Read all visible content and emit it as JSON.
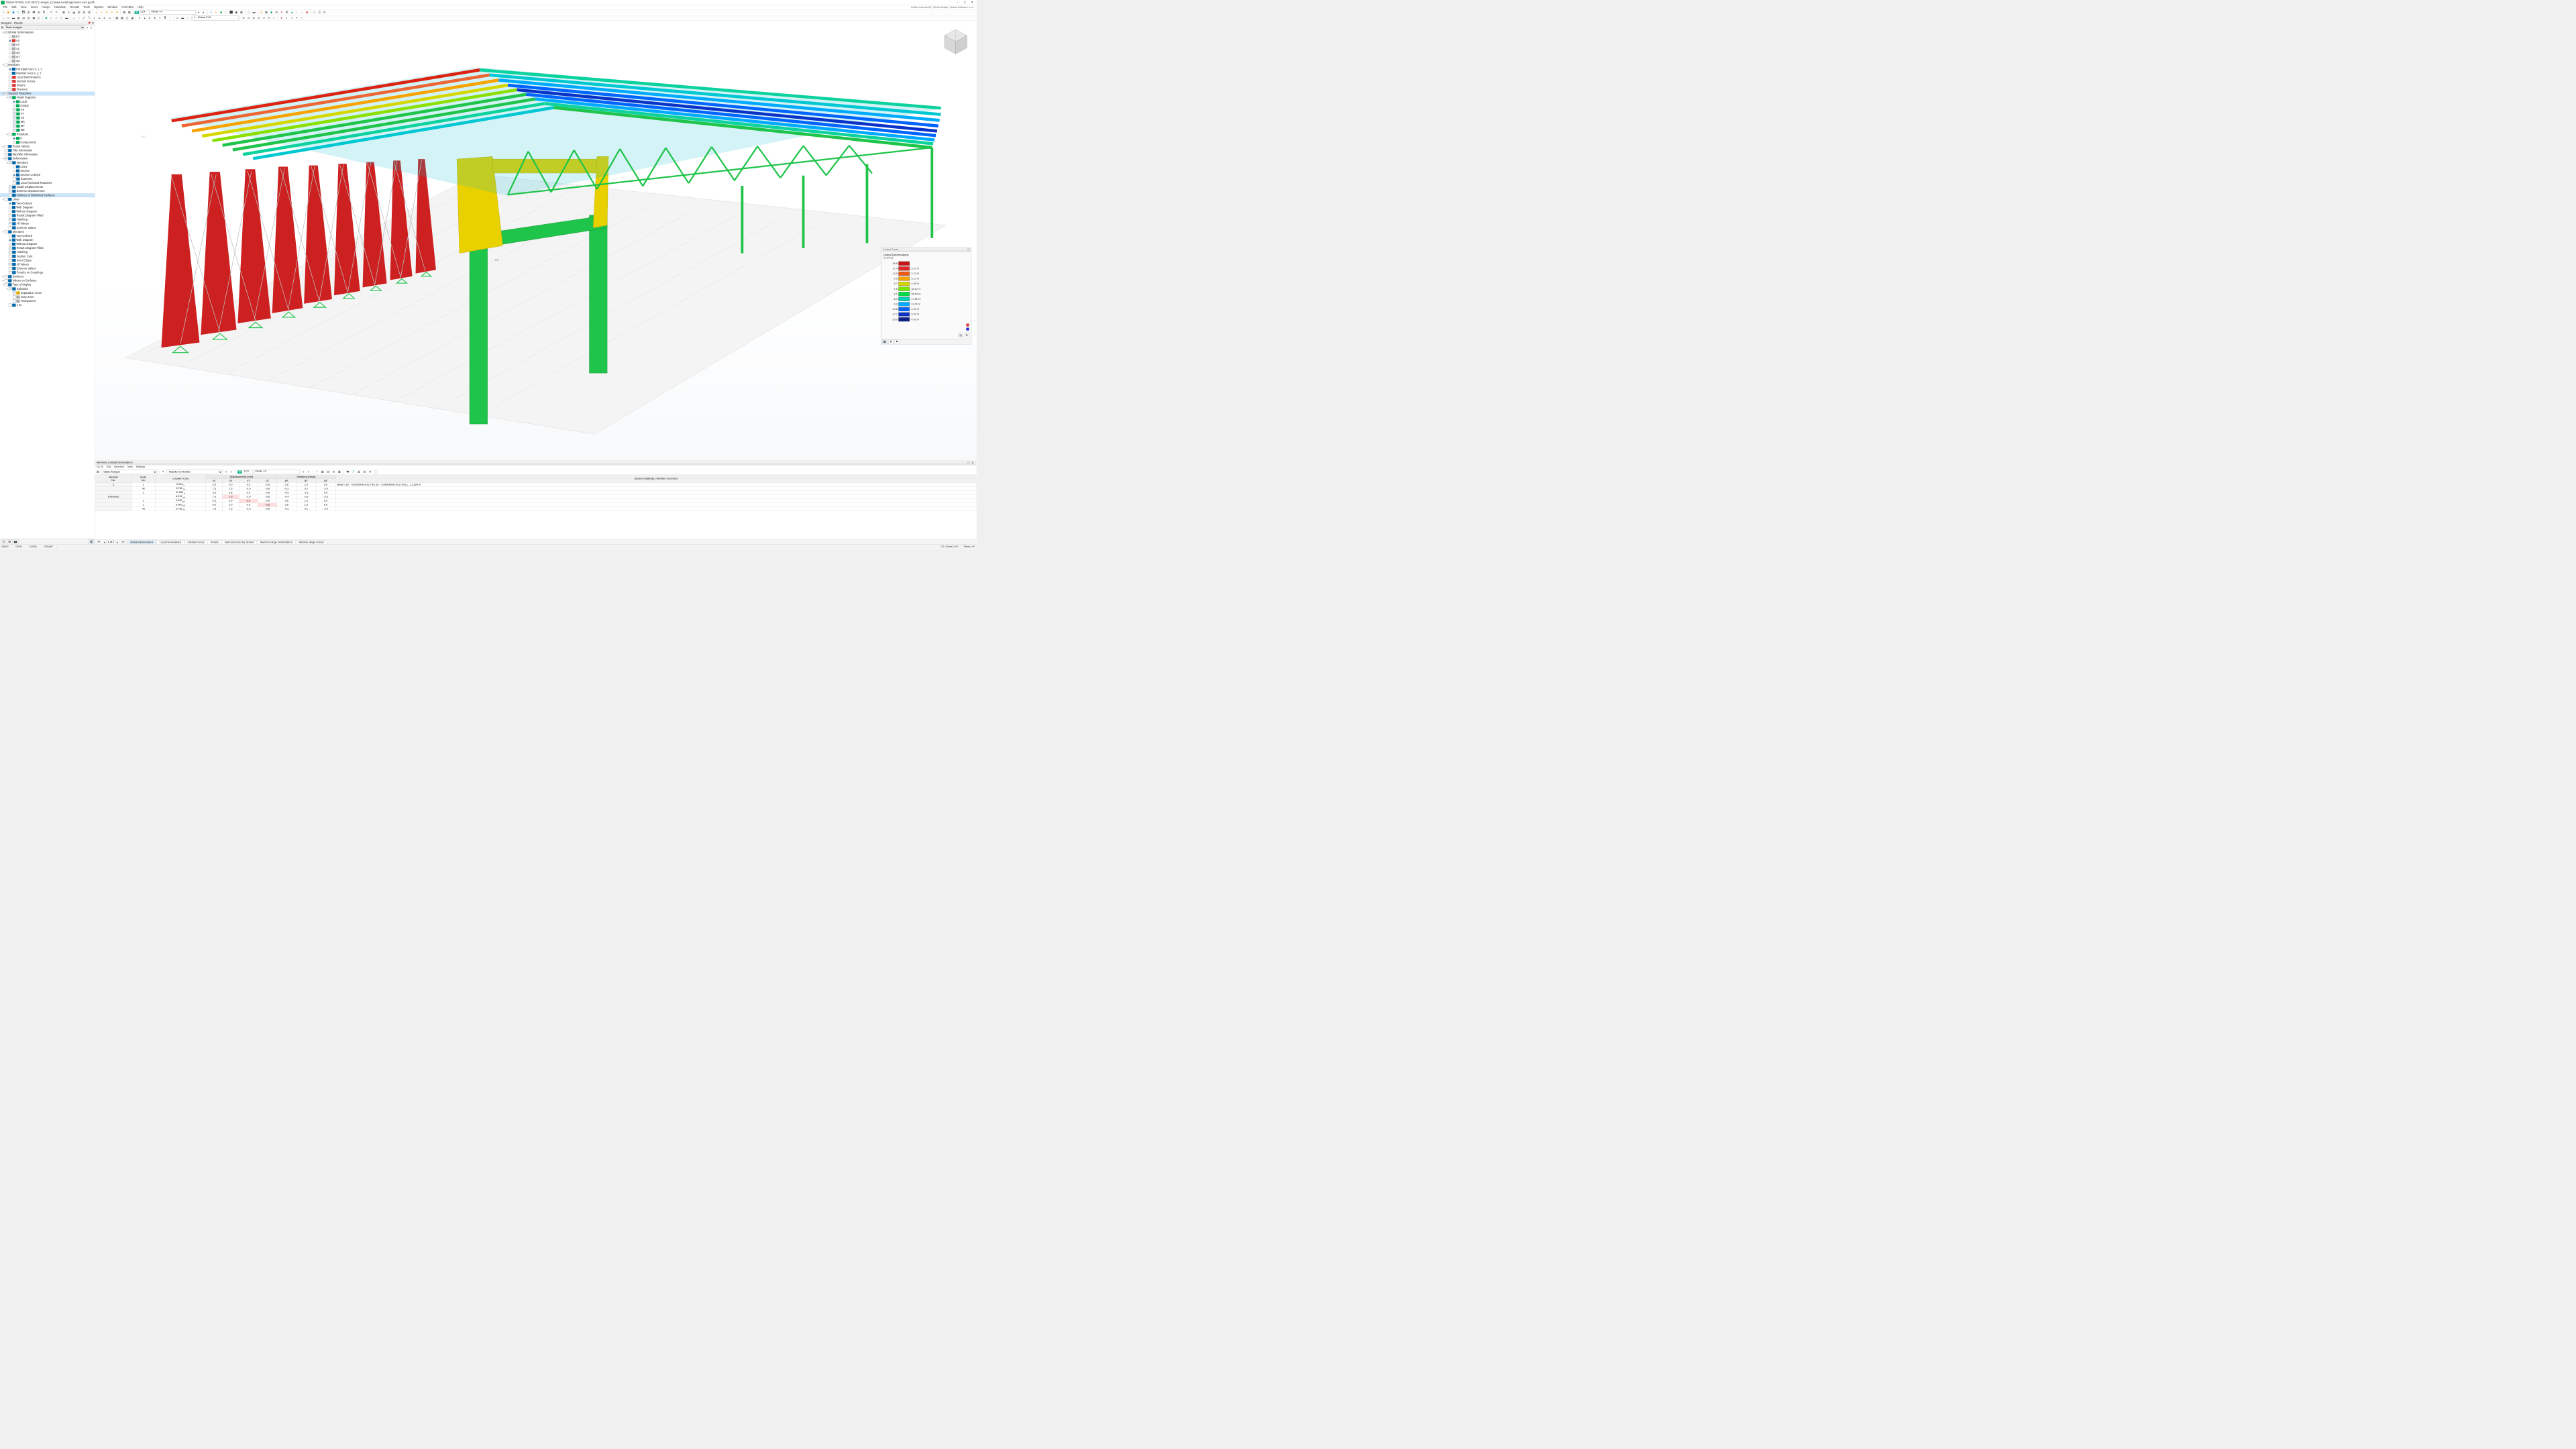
{
  "title": "Dlubal RFEM | 6.02.0047 | Hangar_(C)www.metalurgicavera.com.py.rf5",
  "license": "Online License 53 | Martin Motlik | Dlubal Software s.r.o.",
  "menus": [
    "File",
    "Edit",
    "View",
    "Insert",
    "Assign",
    "Calculate",
    "Results",
    "Tools",
    "Options",
    "Window",
    "CAD-BIM",
    "Help"
  ],
  "lc_badge": "LC4",
  "lc_dropdown": "Viento +X",
  "coord_dropdown": "1 - Global XYZ",
  "nav": {
    "title": "Navigator - Results",
    "analysis": "Static Analysis",
    "tree": [
      {
        "d": 0,
        "caret": "▾",
        "chk": true,
        "lbl": "Global Deformations"
      },
      {
        "d": 1,
        "radio": false,
        "icon": "ti-gray",
        "lbl": "|u|"
      },
      {
        "d": 1,
        "radio": true,
        "icon": "ti-red",
        "lbl": "uX"
      },
      {
        "d": 1,
        "radio": false,
        "icon": "ti-gray",
        "lbl": "uY"
      },
      {
        "d": 1,
        "radio": false,
        "icon": "ti-gray",
        "lbl": "uZ"
      },
      {
        "d": 1,
        "radio": false,
        "icon": "ti-gray",
        "lbl": "φX"
      },
      {
        "d": 1,
        "radio": false,
        "icon": "ti-gray",
        "lbl": "φY"
      },
      {
        "d": 1,
        "radio": false,
        "icon": "ti-gray",
        "lbl": "φZ"
      },
      {
        "d": 0,
        "caret": "▾",
        "chk": false,
        "lbl": "Members"
      },
      {
        "d": 1,
        "radio": true,
        "icon": "ti-blue",
        "lbl": "Principal Axes s, u, v"
      },
      {
        "d": 1,
        "radio": false,
        "icon": "ti-blue",
        "lbl": "Member Axes x, y, z"
      },
      {
        "d": 1,
        "chk": false,
        "icon": "ti-red",
        "lbl": "Local Deformations"
      },
      {
        "d": 1,
        "chk": false,
        "icon": "ti-red",
        "lbl": "Internal Forces"
      },
      {
        "d": 1,
        "chk": false,
        "icon": "ti-red",
        "lbl": "Strains"
      },
      {
        "d": 1,
        "chk": false,
        "icon": "ti-red",
        "lbl": "Stresses"
      },
      {
        "d": 0,
        "caret": "▾",
        "chk": true,
        "lbl": "Support Reactions",
        "sel": true
      },
      {
        "d": 1,
        "caret": "▾",
        "chk": true,
        "icon": "ti-green",
        "lbl": "Nodal Supports"
      },
      {
        "d": 2,
        "radio": true,
        "icon": "ti-green",
        "lbl": "Local"
      },
      {
        "d": 2,
        "radio": false,
        "icon": "ti-green",
        "lbl": "Global"
      },
      {
        "d": 2,
        "chk": true,
        "icon": "ti-green",
        "lbl": "PX"
      },
      {
        "d": 2,
        "chk": true,
        "icon": "ti-green",
        "lbl": "PY"
      },
      {
        "d": 2,
        "chk": true,
        "icon": "ti-green",
        "lbl": "PZ"
      },
      {
        "d": 2,
        "chk": true,
        "icon": "ti-green",
        "lbl": "MX"
      },
      {
        "d": 2,
        "chk": true,
        "icon": "ti-green",
        "lbl": "MY"
      },
      {
        "d": 2,
        "chk": true,
        "icon": "ti-green",
        "lbl": "MZ"
      },
      {
        "d": 1,
        "caret": "▾",
        "chk": false,
        "icon": "ti-green",
        "lbl": "Resultant"
      },
      {
        "d": 2,
        "radio": true,
        "icon": "ti-green",
        "lbl": "P"
      },
      {
        "d": 2,
        "radio": false,
        "icon": "ti-green",
        "lbl": "Components"
      },
      {
        "d": 0,
        "caret": "▸",
        "chk": false,
        "icon": "ti-blue",
        "lbl": "Result Values"
      },
      {
        "d": 0,
        "chk": false,
        "icon": "ti-blue",
        "lbl": "Title Information"
      },
      {
        "d": 0,
        "chk": false,
        "icon": "ti-blue",
        "lbl": "Max/Min Information"
      },
      {
        "d": 0,
        "caret": "▾",
        "chk": true,
        "icon": "ti-blue",
        "lbl": "Deformation"
      },
      {
        "d": 1,
        "caret": "▾",
        "chk": true,
        "icon": "ti-blue",
        "lbl": "Members"
      },
      {
        "d": 2,
        "radio": false,
        "icon": "ti-blue",
        "lbl": "Lines"
      },
      {
        "d": 2,
        "radio": false,
        "icon": "ti-blue",
        "lbl": "Section"
      },
      {
        "d": 2,
        "radio": true,
        "icon": "ti-blue",
        "lbl": "Section Colored"
      },
      {
        "d": 2,
        "chk": false,
        "icon": "ti-blue",
        "lbl": "Extremes"
      },
      {
        "d": 2,
        "chk": false,
        "icon": "ti-blue",
        "lbl": "Local Torsional Rotations"
      },
      {
        "d": 1,
        "chk": true,
        "icon": "ti-blue",
        "lbl": "Nodal Displacements"
      },
      {
        "d": 1,
        "chk": true,
        "icon": "ti-blue",
        "lbl": "Extreme Displacement"
      },
      {
        "d": 1,
        "chk": false,
        "icon": "ti-blue",
        "lbl": "Outlines of Deformed Surfaces",
        "sel": true
      },
      {
        "d": 0,
        "caret": "▾",
        "chk": false,
        "icon": "ti-blue",
        "lbl": "Lines"
      },
      {
        "d": 1,
        "radio": true,
        "icon": "ti-blue",
        "lbl": "Two-Colored"
      },
      {
        "d": 1,
        "radio": false,
        "icon": "ti-blue",
        "lbl": "With Diagram"
      },
      {
        "d": 1,
        "radio": false,
        "icon": "ti-blue",
        "lbl": "Without Diagram"
      },
      {
        "d": 1,
        "chk": false,
        "icon": "ti-blue",
        "lbl": "Result Diagram Filled"
      },
      {
        "d": 1,
        "chk": true,
        "icon": "ti-blue",
        "lbl": "Hatching"
      },
      {
        "d": 1,
        "chk": true,
        "icon": "ti-blue",
        "lbl": "All Values"
      },
      {
        "d": 1,
        "chk": false,
        "icon": "ti-blue",
        "lbl": "Extreme Values"
      },
      {
        "d": 0,
        "caret": "▾",
        "chk": false,
        "icon": "ti-blue",
        "lbl": "Members"
      },
      {
        "d": 1,
        "radio": false,
        "icon": "ti-blue",
        "lbl": "Two-Colored"
      },
      {
        "d": 1,
        "radio": true,
        "icon": "ti-blue",
        "lbl": "With Diagram"
      },
      {
        "d": 1,
        "radio": false,
        "icon": "ti-blue",
        "lbl": "Without Diagram"
      },
      {
        "d": 1,
        "chk": true,
        "icon": "ti-blue",
        "lbl": "Result Diagram Filled"
      },
      {
        "d": 1,
        "chk": true,
        "icon": "ti-blue",
        "lbl": "Hatching"
      },
      {
        "d": 1,
        "chk": false,
        "icon": "ti-blue",
        "lbl": "Section Cuts"
      },
      {
        "d": 1,
        "chk": false,
        "icon": "ti-blue",
        "lbl": "Inner Edges"
      },
      {
        "d": 1,
        "chk": true,
        "icon": "ti-blue",
        "lbl": "All Values"
      },
      {
        "d": 1,
        "chk": false,
        "icon": "ti-blue",
        "lbl": "Extreme Values"
      },
      {
        "d": 1,
        "chk": false,
        "icon": "ti-blue",
        "lbl": "Results on Couplings"
      },
      {
        "d": 0,
        "caret": "▸",
        "chk": false,
        "icon": "ti-blue",
        "lbl": "Surfaces"
      },
      {
        "d": 0,
        "caret": "▸",
        "chk": false,
        "icon": "ti-blue",
        "lbl": "Values on Surfaces"
      },
      {
        "d": 0,
        "caret": "▾",
        "chk": false,
        "icon": "ti-blue",
        "lbl": "Type of display"
      },
      {
        "d": 1,
        "caret": "▾",
        "chk": true,
        "icon": "ti-blue",
        "lbl": "Isobands"
      },
      {
        "d": 2,
        "chk": true,
        "icon": "ti-yel",
        "lbl": "Separation Lines"
      },
      {
        "d": 2,
        "chk": false,
        "icon": "ti-gray",
        "lbl": "Gray Zone"
      },
      {
        "d": 2,
        "chk": false,
        "icon": "ti-gray",
        "lbl": "Transparent"
      },
      {
        "d": 1,
        "chk": false,
        "icon": "ti-blue",
        "lbl": "1 ‰"
      }
    ]
  },
  "ctrl": {
    "title": "Control Panel",
    "h1": "Global Deformations",
    "h2": "uX [mm]",
    "legend": [
      {
        "l": "36.8",
        "c": "#c81414",
        "r": ""
      },
      {
        "l": "17.4",
        "c": "#e12828",
        "r": "3.37 %"
      },
      {
        "l": "13.5",
        "c": "#f05a14",
        "r": "2.22 %"
      },
      {
        "l": "9.6",
        "c": "#f5a500",
        "r": "3.12 %"
      },
      {
        "l": "5.7",
        "c": "#d7d700",
        "r": "4.66 %"
      },
      {
        "l": "1.8",
        "c": "#78e600",
        "r": "18.12 %"
      },
      {
        "l": "-2.1",
        "c": "#00dc46",
        "r": "26.54 %"
      },
      {
        "l": "-6.0",
        "c": "#00d2b4",
        "r": "17.86 %"
      },
      {
        "l": "-9.9",
        "c": "#00aaff",
        "r": "11.16 %"
      },
      {
        "l": "-13.8",
        "c": "#0064ff",
        "r": "4.99 %"
      },
      {
        "l": "-17.7",
        "c": "#0a32c8",
        "r": "3.91 %"
      },
      {
        "l": "-29.9",
        "c": "#0a1e8c",
        "r": "4.05 %"
      }
    ]
  },
  "results": {
    "title": "Members | Global Deformations",
    "menus": [
      "Go To",
      "Edit",
      "Selection",
      "View",
      "Settings"
    ],
    "analysis": "Static Analysis",
    "by": "Results by Member",
    "lc": "LC4",
    "lc_name": "Viento +X",
    "head_groups": [
      "Displacements [mm]",
      "Rotations [mrad]"
    ],
    "cols": [
      "Member No.",
      "Node No.",
      "Location x [m]",
      "|u|",
      "uX",
      "uY",
      "uZ",
      "φX",
      "φY",
      "φZ",
      "Section (Material) | Member Comment"
    ],
    "rows": [
      {
        "m": "1",
        "n": "1",
        "x": "0.000",
        "xs": "u",
        "u": "0.5",
        "ux": "0.0",
        "uy": "0.0",
        "uz": "-0.5",
        "px": "0.5",
        "py": "1.9",
        "pz": "0.0",
        "c": "Beam | 15 - I 500/300/6.4/12.7/6 | 16 - I 2000/300/6.4/12.7/6 | L : 11.524 m"
      },
      {
        "m": "",
        "n": "42",
        "x": "5.762",
        "xs": "¹/₂",
        "u": "7.3",
        "ux": "7.3",
        "uy": "-2.0",
        "uz": "-0.8",
        "px": "-0.2",
        "py": "0.1",
        "pz": "-2.9",
        "c": ""
      },
      {
        "m": "",
        "n": "2",
        "x": "11.524",
        "xs": "e",
        "u": "3.9",
        "ux": "3.8",
        "uy": "0.0",
        "uz": "-0.8",
        "px": "-0.5",
        "py": "-1.3",
        "pz": "0.0",
        "c": ""
      },
      {
        "m": "Extremes",
        "n": "",
        "x": "6.915",
        "xs": "uX",
        "u": "7.6",
        "ux": "7.3",
        "ux_hl": true,
        "uy": "-1.9",
        "uz": "-0.8",
        "px": "-0.4",
        "py": "-0.2",
        "pz": "-2.5",
        "c": ""
      },
      {
        "m": "",
        "n": "1",
        "x": "0.000",
        "xs": "uY",
        "u": "0.5",
        "ux": "0.0",
        "uy": "0.0",
        "uy_hl": true,
        "uz": "-0.5",
        "px": "0.5",
        "py": "1.9",
        "pz": "0.0",
        "c": ""
      },
      {
        "m": "",
        "n": "1",
        "x": "0.000",
        "xs": "uZ",
        "u": "0.5",
        "ux": "0.0",
        "uy": "0.0",
        "uz": "-0.5",
        "uz_hl": true,
        "px": "0.5",
        "py": "1.9",
        "pz": "0.0",
        "c": ""
      },
      {
        "m": "",
        "n": "42",
        "x": "5.762",
        "xs": "¹/₂",
        "u": "7.6",
        "ux": "7.3",
        "uy": "-2.0",
        "uz": "-0.8",
        "px": "-0.2",
        "py": "0.1",
        "pz": "-2.9",
        "c": ""
      }
    ],
    "pager": "1 of 7",
    "tabs": [
      "Global Deformations",
      "Local Deformations",
      "Internal Forces",
      "Strains",
      "Internal Forces by Section",
      "Member Hinge Deformations",
      "Member Hinge Forces"
    ]
  },
  "status": {
    "cs": "CS: Global XYZ",
    "plane": "Plane: XY",
    "toggles": [
      "SNAP",
      "GRID",
      "LGRID",
      "OSNAP"
    ]
  }
}
